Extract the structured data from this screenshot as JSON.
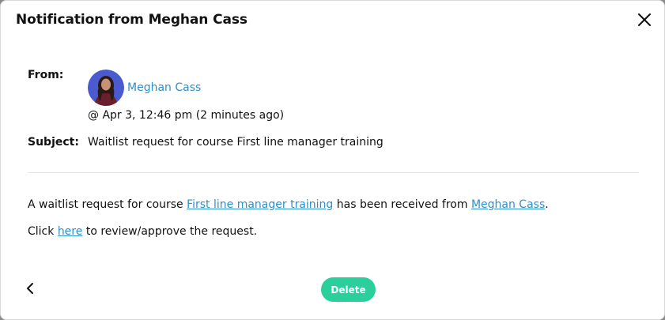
{
  "modal": {
    "title": "Notification from Meghan Cass"
  },
  "details": {
    "from_label": "From:",
    "sender_name": "Meghan Cass",
    "timestamp": "@ Apr 3, 12:46 pm (2 minutes ago)",
    "subject_label": "Subject:",
    "subject_value": "Waitlist request for course First line manager training"
  },
  "message": {
    "line1_prefix": "A waitlist request for course ",
    "course_link": "First line manager training",
    "line1_middle": " has been received from ",
    "sender_link": "Meghan Cass",
    "line1_suffix": ".",
    "line2_prefix": "Click ",
    "here_link": "here",
    "line2_suffix": " to review/approve the request."
  },
  "footer": {
    "delete_label": "Delete"
  },
  "colors": {
    "link": "#2f8fc8",
    "delete_button": "#2bcf9b",
    "avatar_bg": "#4a5bd0"
  },
  "icons": {
    "close": "close-icon",
    "back": "chevron-left-icon"
  }
}
